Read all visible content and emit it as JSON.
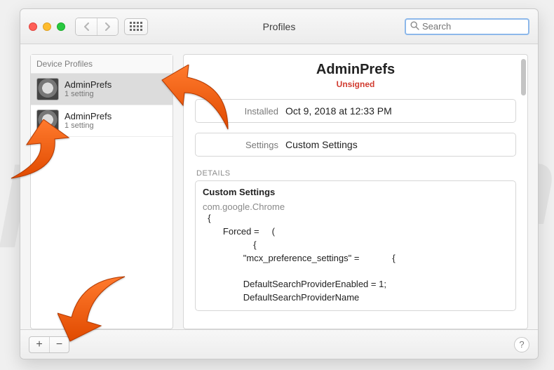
{
  "window": {
    "title": "Profiles"
  },
  "search": {
    "placeholder": "Search"
  },
  "sidebar": {
    "header": "Device Profiles",
    "items": [
      {
        "name": "AdminPrefs",
        "sub": "1 setting",
        "selected": true
      },
      {
        "name": "AdminPrefs",
        "sub": "1 setting",
        "selected": false
      }
    ]
  },
  "main": {
    "title": "AdminPrefs",
    "status": "Unsigned",
    "rows": [
      {
        "label": "Installed",
        "value": "Oct 9, 2018 at 12:33 PM"
      },
      {
        "label": "Settings",
        "value": "Custom Settings"
      }
    ],
    "details_label": "DETAILS",
    "details": {
      "title": "Custom Settings",
      "domain": "com.google.Chrome",
      "body": "  {\n        Forced =     (\n                    {\n                \"mcx_preference_settings\" =             {\n\n                DefaultSearchProviderEnabled = 1;\n                DefaultSearchProviderName"
    }
  },
  "footer": {
    "plus": "+",
    "minus": "−",
    "help": "?"
  },
  "watermark": "pcrisk.com"
}
